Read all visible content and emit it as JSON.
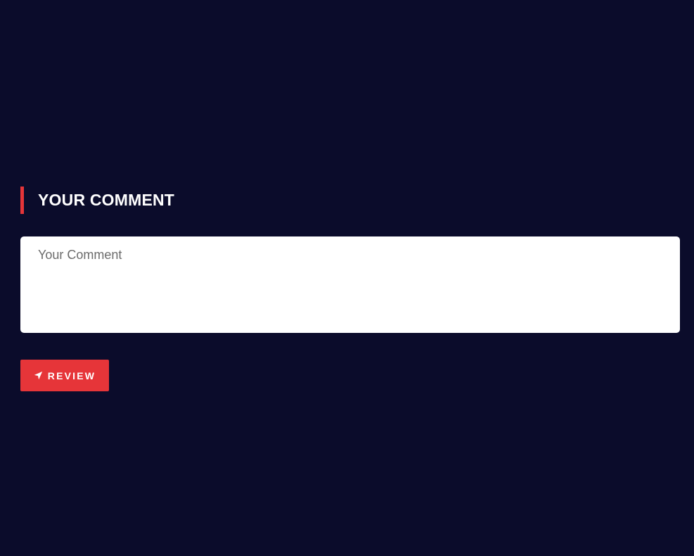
{
  "comment_section": {
    "heading": "YOUR COMMENT",
    "textarea": {
      "placeholder": "Your Comment",
      "value": ""
    },
    "submit": {
      "label": "REVIEW",
      "icon": "location-arrow-icon"
    }
  },
  "colors": {
    "background": "#0b0c2b",
    "accent": "#e63539",
    "heading_text": "#ffffff",
    "input_background": "#ffffff",
    "placeholder_text": "#6b6b6b"
  }
}
